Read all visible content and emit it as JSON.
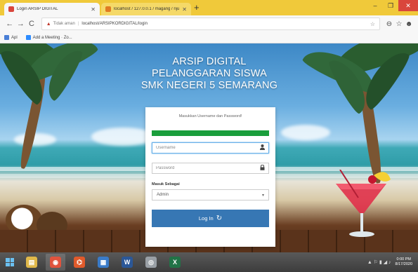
{
  "browser": {
    "tabs": [
      {
        "title": "Login ARSIP DIGITAL",
        "active": true,
        "favicon_color": "#d9463c"
      },
      {
        "title": "localhost / 127.0.0.1 / magang / nju",
        "active": false,
        "favicon_color": "#e07b22"
      }
    ],
    "new_tab": "+",
    "window_controls": {
      "minimize": "–",
      "maximize": "❐",
      "close": "✕"
    },
    "nav": {
      "back": "←",
      "forward": "→",
      "reload": "C"
    },
    "address": {
      "warning_icon": "▲",
      "security": "Tidak aman",
      "separator": "|",
      "url": "localhost/ARSIPKORDIGITAL/login",
      "star": "☆"
    },
    "menu_icons": {
      "zoom": "⊖",
      "star": "☆",
      "account": "☻"
    },
    "bookmarks": [
      {
        "label": "Apl",
        "icon_color": "#4a7fd6"
      },
      {
        "label": "Add a Meeting · Zo...",
        "icon_color": "#2d8cff"
      }
    ]
  },
  "page": {
    "heading_lines": [
      "ARSIP DIGITAL",
      "PELANGGARAN SISWA",
      "SMK NEGERI 5 SEMARANG"
    ],
    "form": {
      "message": "Masukkan Username dan Password!",
      "progress": 1.0,
      "username_placeholder": "Username",
      "username_icon": "user-icon",
      "password_placeholder": "Password",
      "password_icon": "lock-icon",
      "role_label": "Masuk Sebagai",
      "role_value": "Admin",
      "role_caret": "▾",
      "login_label": "Log In",
      "login_icon": "↻"
    }
  },
  "taskbar": {
    "apps": [
      {
        "name": "file-explorer",
        "color": "#e0b84a",
        "glyph": "▤"
      },
      {
        "name": "chrome",
        "color": "#e0533d",
        "glyph": "◉"
      },
      {
        "name": "office",
        "color": "#e05a2b",
        "glyph": "⌬"
      },
      {
        "name": "calculator",
        "color": "#3a7bc8",
        "glyph": "▦"
      },
      {
        "name": "word",
        "color": "#2b5797",
        "glyph": "W"
      },
      {
        "name": "disc",
        "color": "#9aa0a6",
        "glyph": "◎"
      },
      {
        "name": "excel",
        "color": "#217346",
        "glyph": "X"
      }
    ],
    "tray_icons": "▲ ⚐ ▮ ◢ ♪",
    "clock": {
      "time": "0:00 PM",
      "date": "8/17/2020"
    }
  }
}
